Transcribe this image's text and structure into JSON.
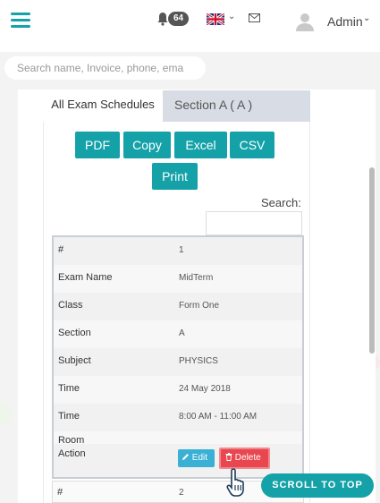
{
  "header": {
    "notification_count": "64",
    "user_name": "Admin",
    "chevron": "⌄"
  },
  "search": {
    "placeholder": "Search name, Invoice, phone, ema"
  },
  "tabs": [
    {
      "label": "All Exam Schedules"
    },
    {
      "label": "Section A ( A )"
    }
  ],
  "export_buttons": {
    "pdf": "PDF",
    "copy": "Copy",
    "excel": "Excel",
    "csv": "CSV",
    "print": "Print"
  },
  "table_search_label": "Search:",
  "record": {
    "rows": [
      {
        "key": "#",
        "value": "1"
      },
      {
        "key": "Exam Name",
        "value": "MidTerm"
      },
      {
        "key": "Class",
        "value": "Form One"
      },
      {
        "key": "Section",
        "value": "A"
      },
      {
        "key": "Subject",
        "value": "PHYSICS"
      },
      {
        "key": "Time",
        "value": "24 May 2018"
      },
      {
        "key": "Time",
        "value": "8:00 AM - 11:00 AM"
      },
      {
        "key": "Room",
        "value": ""
      }
    ],
    "action_label": "Action",
    "edit_label": "Edit",
    "delete_label": "Delete"
  },
  "next_record": {
    "key": "#",
    "value": "2"
  },
  "scroll_to_top": "SCROLL TO TOP",
  "colors": {
    "accent": "#14a2a8",
    "edit": "#3ab0d4",
    "delete": "#e8474f"
  },
  "icons": [
    "menu-icon",
    "bell-icon",
    "uk-flag-icon",
    "mail-icon",
    "user-avatar-icon",
    "pencil-icon",
    "trash-icon",
    "pointer-hand-icon"
  ]
}
